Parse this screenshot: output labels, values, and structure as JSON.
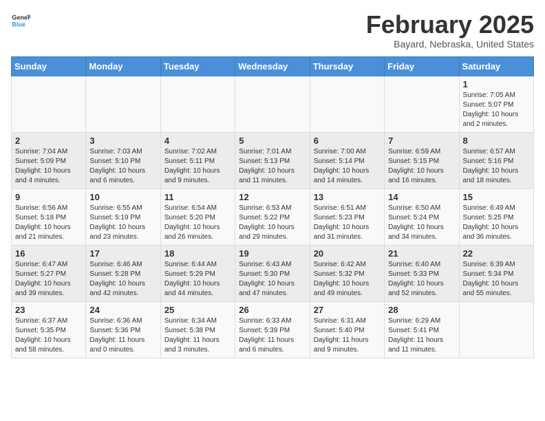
{
  "header": {
    "logo_general": "General",
    "logo_blue": "Blue",
    "month_title": "February 2025",
    "location": "Bayard, Nebraska, United States"
  },
  "weekdays": [
    "Sunday",
    "Monday",
    "Tuesday",
    "Wednesday",
    "Thursday",
    "Friday",
    "Saturday"
  ],
  "weeks": [
    [
      {
        "day": "",
        "info": ""
      },
      {
        "day": "",
        "info": ""
      },
      {
        "day": "",
        "info": ""
      },
      {
        "day": "",
        "info": ""
      },
      {
        "day": "",
        "info": ""
      },
      {
        "day": "",
        "info": ""
      },
      {
        "day": "1",
        "info": "Sunrise: 7:05 AM\nSunset: 5:07 PM\nDaylight: 10 hours and 2 minutes."
      }
    ],
    [
      {
        "day": "2",
        "info": "Sunrise: 7:04 AM\nSunset: 5:09 PM\nDaylight: 10 hours and 4 minutes."
      },
      {
        "day": "3",
        "info": "Sunrise: 7:03 AM\nSunset: 5:10 PM\nDaylight: 10 hours and 6 minutes."
      },
      {
        "day": "4",
        "info": "Sunrise: 7:02 AM\nSunset: 5:11 PM\nDaylight: 10 hours and 9 minutes."
      },
      {
        "day": "5",
        "info": "Sunrise: 7:01 AM\nSunset: 5:13 PM\nDaylight: 10 hours and 11 minutes."
      },
      {
        "day": "6",
        "info": "Sunrise: 7:00 AM\nSunset: 5:14 PM\nDaylight: 10 hours and 14 minutes."
      },
      {
        "day": "7",
        "info": "Sunrise: 6:59 AM\nSunset: 5:15 PM\nDaylight: 10 hours and 16 minutes."
      },
      {
        "day": "8",
        "info": "Sunrise: 6:57 AM\nSunset: 5:16 PM\nDaylight: 10 hours and 18 minutes."
      }
    ],
    [
      {
        "day": "9",
        "info": "Sunrise: 6:56 AM\nSunset: 5:18 PM\nDaylight: 10 hours and 21 minutes."
      },
      {
        "day": "10",
        "info": "Sunrise: 6:55 AM\nSunset: 5:19 PM\nDaylight: 10 hours and 23 minutes."
      },
      {
        "day": "11",
        "info": "Sunrise: 6:54 AM\nSunset: 5:20 PM\nDaylight: 10 hours and 26 minutes."
      },
      {
        "day": "12",
        "info": "Sunrise: 6:53 AM\nSunset: 5:22 PM\nDaylight: 10 hours and 29 minutes."
      },
      {
        "day": "13",
        "info": "Sunrise: 6:51 AM\nSunset: 5:23 PM\nDaylight: 10 hours and 31 minutes."
      },
      {
        "day": "14",
        "info": "Sunrise: 6:50 AM\nSunset: 5:24 PM\nDaylight: 10 hours and 34 minutes."
      },
      {
        "day": "15",
        "info": "Sunrise: 6:49 AM\nSunset: 5:25 PM\nDaylight: 10 hours and 36 minutes."
      }
    ],
    [
      {
        "day": "16",
        "info": "Sunrise: 6:47 AM\nSunset: 5:27 PM\nDaylight: 10 hours and 39 minutes."
      },
      {
        "day": "17",
        "info": "Sunrise: 6:46 AM\nSunset: 5:28 PM\nDaylight: 10 hours and 42 minutes."
      },
      {
        "day": "18",
        "info": "Sunrise: 6:44 AM\nSunset: 5:29 PM\nDaylight: 10 hours and 44 minutes."
      },
      {
        "day": "19",
        "info": "Sunrise: 6:43 AM\nSunset: 5:30 PM\nDaylight: 10 hours and 47 minutes."
      },
      {
        "day": "20",
        "info": "Sunrise: 6:42 AM\nSunset: 5:32 PM\nDaylight: 10 hours and 49 minutes."
      },
      {
        "day": "21",
        "info": "Sunrise: 6:40 AM\nSunset: 5:33 PM\nDaylight: 10 hours and 52 minutes."
      },
      {
        "day": "22",
        "info": "Sunrise: 6:39 AM\nSunset: 5:34 PM\nDaylight: 10 hours and 55 minutes."
      }
    ],
    [
      {
        "day": "23",
        "info": "Sunrise: 6:37 AM\nSunset: 5:35 PM\nDaylight: 10 hours and 58 minutes."
      },
      {
        "day": "24",
        "info": "Sunrise: 6:36 AM\nSunset: 5:36 PM\nDaylight: 11 hours and 0 minutes."
      },
      {
        "day": "25",
        "info": "Sunrise: 6:34 AM\nSunset: 5:38 PM\nDaylight: 11 hours and 3 minutes."
      },
      {
        "day": "26",
        "info": "Sunrise: 6:33 AM\nSunset: 5:39 PM\nDaylight: 11 hours and 6 minutes."
      },
      {
        "day": "27",
        "info": "Sunrise: 6:31 AM\nSunset: 5:40 PM\nDaylight: 11 hours and 9 minutes."
      },
      {
        "day": "28",
        "info": "Sunrise: 6:29 AM\nSunset: 5:41 PM\nDaylight: 11 hours and 11 minutes."
      },
      {
        "day": "",
        "info": ""
      }
    ]
  ]
}
